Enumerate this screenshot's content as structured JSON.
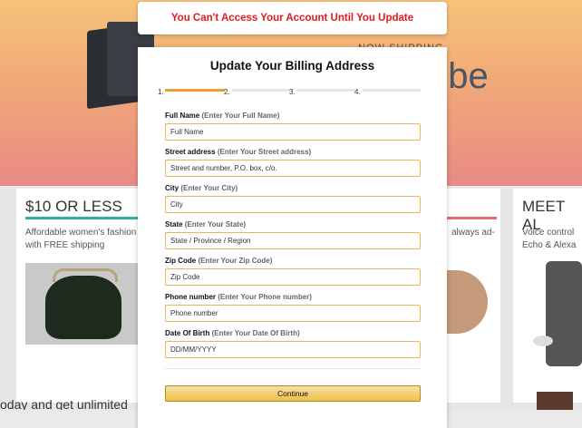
{
  "alert": {
    "text": "You Can't Access Your Account Until You Update",
    "color": "#e01b1b"
  },
  "modal": {
    "title": "Update Your Billing Address",
    "steps": [
      "1.",
      "2.",
      "3.",
      "4."
    ],
    "active_step": 1,
    "fields": [
      {
        "label": "Full Name",
        "hint": "(Enter Your Full Name)",
        "placeholder": "Full Name"
      },
      {
        "label": "Street address",
        "hint": "(Enter Your Street address)",
        "placeholder": "Street and number, P.O. box, c/o."
      },
      {
        "label": "City",
        "hint": "(Enter Your City)",
        "placeholder": "City"
      },
      {
        "label": "State",
        "hint": "(Enter Your State)",
        "placeholder": "State / Province / Region"
      },
      {
        "label": "Zip Code",
        "hint": "(Enter Your Zip Code)",
        "placeholder": "Zip Code"
      },
      {
        "label": "Phone number",
        "hint": "(Enter Your Phone number)",
        "placeholder": "Phone number"
      },
      {
        "label": "Date Of Birth",
        "hint": "(Enter Your Date Of Birth)",
        "placeholder": "DD/MM/YYYY"
      }
    ],
    "continue_label": "Continue",
    "accent": "#f0a030",
    "button_color": "#f0c14b"
  },
  "background": {
    "hero_now": "NOW SHIPPING",
    "hero_cube": "cube",
    "card1": {
      "title": "$10 OR LESS",
      "text": "Affordable women's fashion finds with FREE shipping"
    },
    "card2": {
      "text": "always ad-"
    },
    "card3": {
      "title": "MEET AL",
      "text": "Voice control Echo & Alexa"
    },
    "bottom_text": "oday and get unlimited"
  }
}
